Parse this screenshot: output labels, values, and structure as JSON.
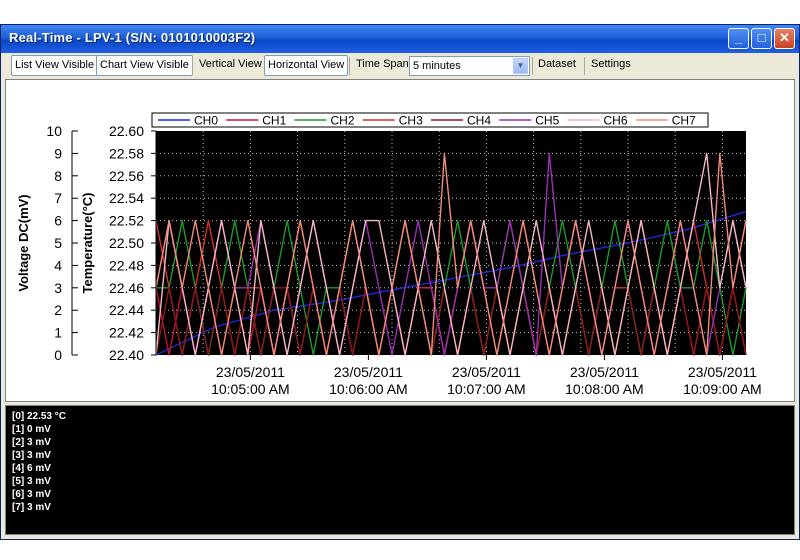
{
  "window": {
    "title": "Real-Time - LPV-1 (S/N: 0101010003F2)",
    "minimize_glyph": "_",
    "maximize_glyph": "□",
    "close_glyph": "✕"
  },
  "toolbar": {
    "list_view": "List View Visible",
    "chart_view": "Chart View Visible",
    "vertical_view": "Vertical View",
    "horizontal_view": "Horizontal View",
    "time_span_label": "Time Span",
    "time_span_value": "5 minutes",
    "dataset": "Dataset",
    "settings": "Settings"
  },
  "chart_data": {
    "type": "line",
    "xlabel": "5 minutes",
    "left_axis": {
      "label": "Voltage DC(mV)",
      "ylim": [
        0,
        10
      ],
      "ticks": [
        0,
        1,
        2,
        3,
        4,
        5,
        6,
        7,
        8,
        9,
        10
      ]
    },
    "right_axis": {
      "label": "Temperature(°C)",
      "ylim": [
        22.4,
        22.6
      ],
      "ticks": [
        "22.40",
        "22.42",
        "22.44",
        "22.46",
        "22.48",
        "22.50",
        "22.52",
        "22.54",
        "22.56",
        "22.58",
        "22.60"
      ]
    },
    "x_ticks": [
      {
        "date": "23/05/2011",
        "time": "10:05:00 AM",
        "t": 0.8
      },
      {
        "date": "23/05/2011",
        "time": "10:06:00 AM",
        "t": 1.8
      },
      {
        "date": "23/05/2011",
        "time": "10:07:00 AM",
        "t": 2.8
      },
      {
        "date": "23/05/2011",
        "time": "10:08:00 AM",
        "t": 3.8
      },
      {
        "date": "23/05/2011",
        "time": "10:09:00 AM",
        "t": 4.8
      }
    ],
    "xlim": [
      0,
      5
    ],
    "grid": true,
    "legend_position": "top",
    "series": [
      {
        "name": "CH0",
        "color": "#1a2bd6",
        "axis": "temperature",
        "x": [
          0,
          0.5,
          1,
          1.5,
          2,
          2.5,
          3,
          3.5,
          4,
          4.5,
          5
        ],
        "values": [
          22.4,
          22.425,
          22.44,
          22.448,
          22.458,
          22.468,
          22.478,
          22.49,
          22.5,
          22.512,
          22.528
        ]
      },
      {
        "name": "CH1",
        "color": "#c8102e",
        "axis": "voltage",
        "values": [
          3,
          0,
          3,
          0,
          3,
          0,
          3,
          0,
          3,
          0,
          3,
          0,
          3,
          0,
          3,
          0,
          3,
          0,
          3,
          0,
          3,
          0,
          3,
          0,
          3,
          0,
          3,
          0,
          3,
          0,
          3,
          0,
          3,
          0,
          3,
          0,
          3,
          0,
          3,
          0,
          3,
          0,
          3,
          0,
          3,
          0
        ]
      },
      {
        "name": "CH2",
        "color": "#1e9a2a",
        "axis": "voltage",
        "values": [
          3,
          3,
          6,
          3,
          0,
          3,
          6,
          3,
          0,
          3,
          6,
          3,
          0,
          3,
          3,
          6,
          3,
          0,
          3,
          6,
          3,
          0,
          3,
          6,
          3,
          0,
          3,
          6,
          3,
          0,
          3,
          6,
          3,
          0,
          3,
          6,
          3,
          0,
          3,
          6,
          3,
          3,
          6,
          3,
          0,
          3
        ]
      },
      {
        "name": "CH3",
        "color": "#d2312f",
        "axis": "voltage",
        "values": [
          6,
          3,
          0,
          3,
          6,
          3,
          0,
          3,
          3,
          0,
          3,
          6,
          3,
          0,
          3,
          6,
          3,
          0,
          3,
          6,
          3,
          3,
          0,
          3,
          6,
          3,
          0,
          3,
          6,
          3,
          0,
          3,
          6,
          3,
          0,
          3,
          3,
          6,
          3,
          0,
          3,
          6,
          3,
          0,
          3,
          6
        ]
      },
      {
        "name": "CH4",
        "color": "#8b1a1a",
        "axis": "voltage",
        "values": [
          0,
          3,
          0,
          3,
          0,
          3,
          0,
          3,
          0,
          3,
          3,
          0,
          3,
          0,
          3,
          0,
          3,
          0,
          3,
          0,
          3,
          0,
          3,
          0,
          3,
          0,
          3,
          0,
          3,
          0,
          3,
          0,
          3,
          0,
          3,
          0,
          3,
          0,
          3,
          0,
          3,
          0,
          3,
          0,
          3,
          0
        ]
      },
      {
        "name": "CH5",
        "color": "#9a2fb0",
        "axis": "voltage",
        "values": [
          3,
          6,
          3,
          0,
          3,
          6,
          3,
          3,
          6,
          3,
          0,
          3,
          6,
          3,
          0,
          3,
          6,
          3,
          0,
          3,
          6,
          3,
          0,
          3,
          6,
          3,
          3,
          6,
          3,
          0,
          9,
          3,
          6,
          3,
          0,
          3,
          6,
          3,
          0,
          3,
          6,
          3,
          0,
          3,
          6,
          3
        ]
      },
      {
        "name": "CH6",
        "color": "#f2b8c2",
        "axis": "voltage",
        "values": [
          0,
          6,
          3,
          0,
          3,
          6,
          3,
          0,
          6,
          3,
          0,
          3,
          6,
          3,
          0,
          3,
          6,
          6,
          3,
          0,
          3,
          6,
          3,
          0,
          3,
          6,
          3,
          0,
          3,
          6,
          3,
          0,
          3,
          6,
          3,
          0,
          3,
          6,
          3,
          0,
          3,
          6,
          9,
          3,
          6,
          3
        ]
      },
      {
        "name": "CH7",
        "color": "#f08c78",
        "axis": "voltage",
        "values": [
          3,
          6,
          3,
          6,
          3,
          0,
          3,
          6,
          3,
          0,
          3,
          6,
          3,
          0,
          3,
          6,
          3,
          0,
          3,
          6,
          3,
          0,
          9,
          3,
          6,
          3,
          0,
          3,
          6,
          3,
          0,
          3,
          6,
          3,
          0,
          3,
          6,
          3,
          0,
          3,
          6,
          3,
          0,
          9,
          3,
          6
        ]
      }
    ]
  },
  "readings": [
    "[0] 22.53 °C",
    "[1] 0 mV",
    "[2] 3 mV",
    "[3] 3 mV",
    "[4] 6 mV",
    "[5] 3 mV",
    "[6] 3 mV",
    "[7] 3 mV"
  ]
}
